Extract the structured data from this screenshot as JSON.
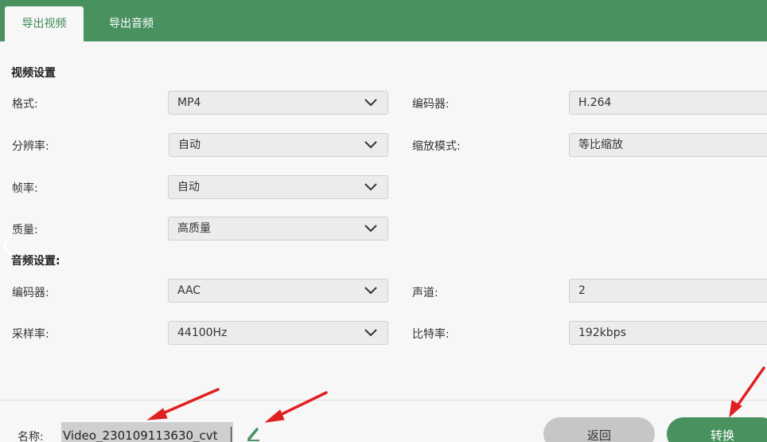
{
  "tabs": [
    {
      "label": "导出视频",
      "active": true
    },
    {
      "label": "导出音频",
      "active": false
    }
  ],
  "video_settings": {
    "title": "视频设置",
    "format": {
      "label": "格式:",
      "value": "MP4"
    },
    "encoder": {
      "label": "编码器:",
      "value": "H.264"
    },
    "resolution": {
      "label": "分辨率:",
      "value": "自动"
    },
    "zoom_mode": {
      "label": "缩放模式:",
      "value": "等比缩放"
    },
    "frame_rate": {
      "label": "帧率:",
      "value": "自动"
    },
    "quality": {
      "label": "质量:",
      "value": "高质量"
    }
  },
  "audio_settings": {
    "title": "音频设置:",
    "encoder": {
      "label": "编码器:",
      "value": "AAC"
    },
    "channel": {
      "label": "声道:",
      "value": "2"
    },
    "sample_rate": {
      "label": "采样率:",
      "value": "44100Hz"
    },
    "bitrate": {
      "label": "比特率:",
      "value": "192kbps"
    }
  },
  "footer": {
    "name_label": "名称:",
    "name_value": "Video_230109113630_cvt",
    "back_label": "返回",
    "convert_label": "转换"
  },
  "colors": {
    "accent": "#4a9160",
    "annotation_arrow": "#e02020"
  },
  "icons": [
    "chevron-down-icon",
    "chevron-left-icon",
    "pencil-icon",
    "annotation-arrow-icon"
  ]
}
